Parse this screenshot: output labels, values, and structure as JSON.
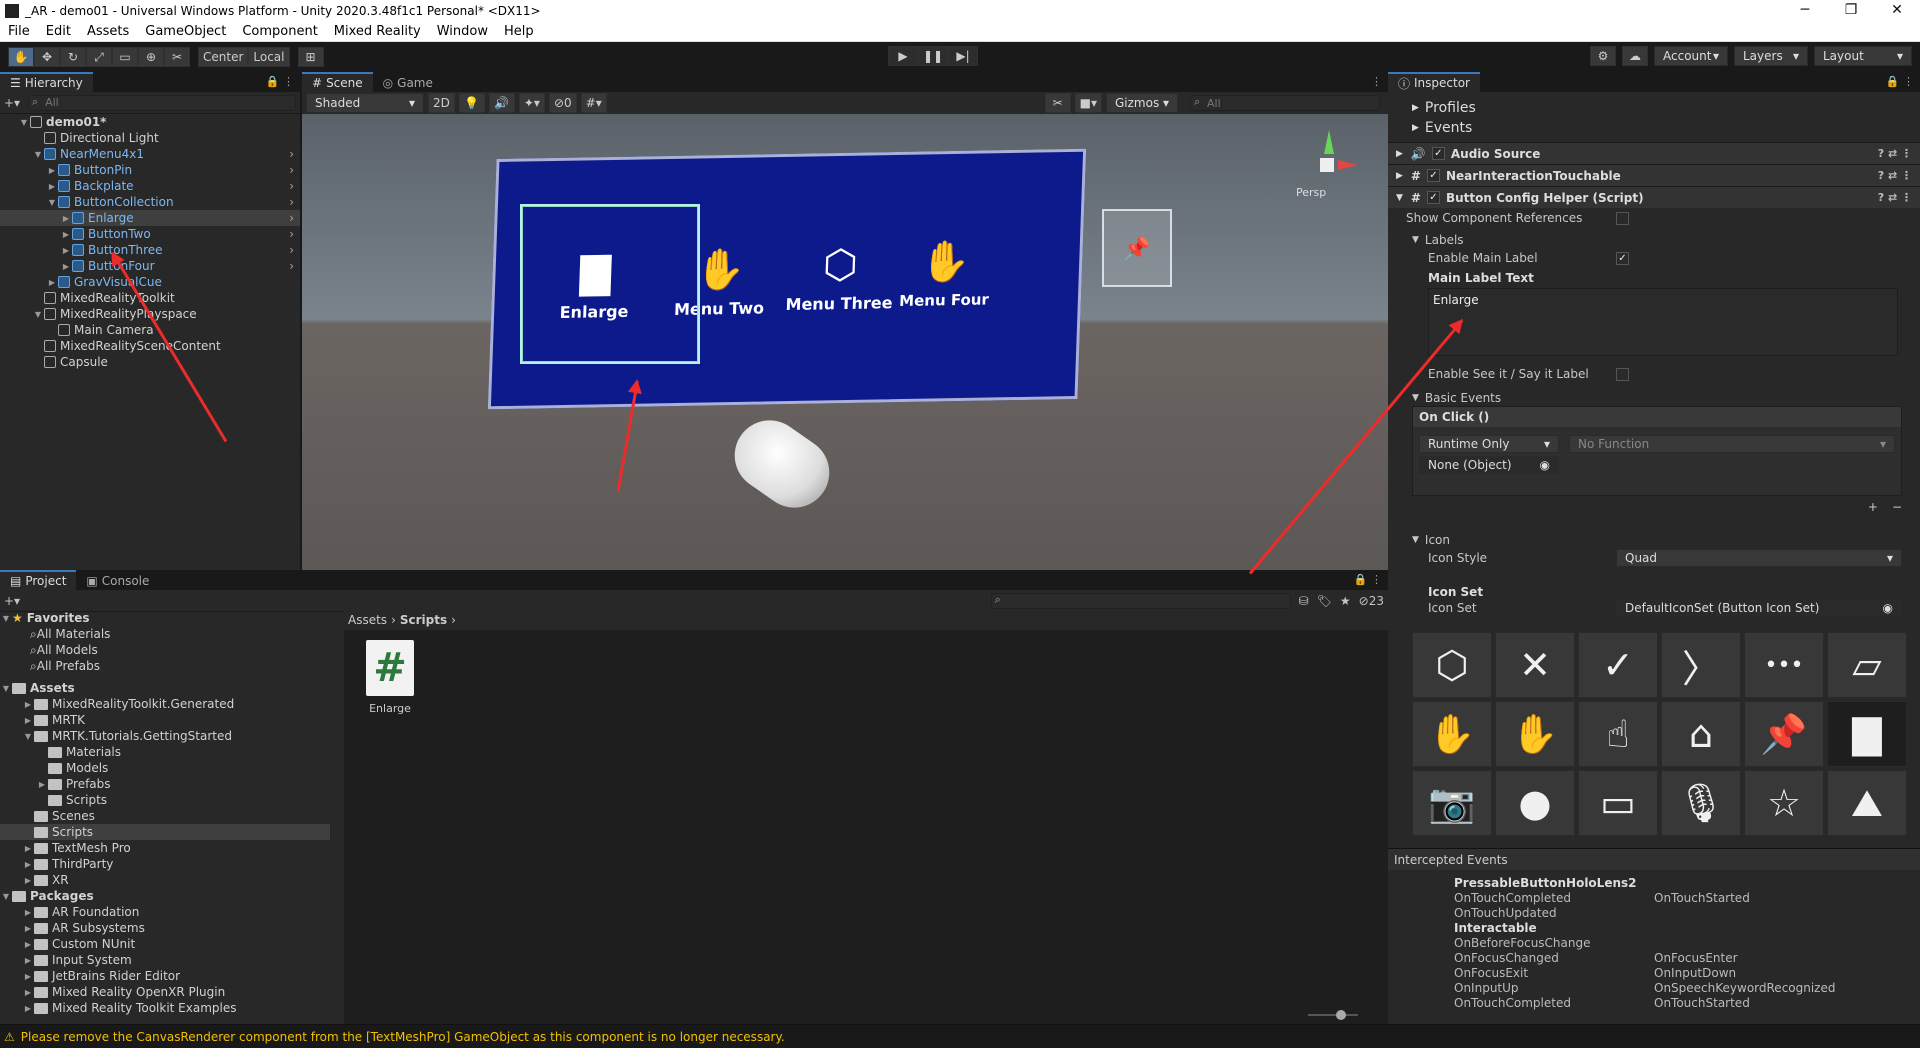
{
  "window": {
    "title": "_AR - demo01 - Universal Windows Platform - Unity 2020.3.48f1c1 Personal* <DX11>",
    "min": "─",
    "max": "❐",
    "close": "✕"
  },
  "menu": [
    "File",
    "Edit",
    "Assets",
    "GameObject",
    "Component",
    "Mixed Reality",
    "Window",
    "Help"
  ],
  "toolbar": {
    "center": "Center",
    "local": "Local",
    "account": "Account",
    "layers": "Layers",
    "layout": "Layout"
  },
  "hierarchy": {
    "tab": "Hierarchy",
    "search_placeholder": "All",
    "rows": [
      {
        "label": "demo01*",
        "depth": 0,
        "bold": true
      },
      {
        "label": "Directional Light",
        "depth": 1
      },
      {
        "label": "NearMenu4x1",
        "depth": 1,
        "blue": true
      },
      {
        "label": "ButtonPin",
        "depth": 2,
        "blue": true
      },
      {
        "label": "Backplate",
        "depth": 2,
        "blue": true
      },
      {
        "label": "ButtonCollection",
        "depth": 2,
        "blue": true
      },
      {
        "label": "Enlarge",
        "depth": 3,
        "blue": true,
        "selected": true
      },
      {
        "label": "ButtonTwo",
        "depth": 3,
        "blue": true
      },
      {
        "label": "ButtonThree",
        "depth": 3,
        "blue": true
      },
      {
        "label": "ButtonFour",
        "depth": 3,
        "blue": true
      },
      {
        "label": "GravVisualCue",
        "depth": 2,
        "blue": true
      },
      {
        "label": "MixedRealityToolkit",
        "depth": 1
      },
      {
        "label": "MixedRealityPlayspace",
        "depth": 1
      },
      {
        "label": "Main Camera",
        "depth": 2
      },
      {
        "label": "MixedRealitySceneContent",
        "depth": 1
      },
      {
        "label": "Capsule",
        "depth": 1
      }
    ]
  },
  "scene": {
    "tab_scene": "Scene",
    "tab_game": "Game",
    "shading": "Shaded",
    "mode2d": "2D",
    "gizmos": "Gizmos",
    "search_placeholder": "All",
    "persp": "Persp",
    "layers_count": "0",
    "menu_items": [
      {
        "label": "Enlarge",
        "icon": "bar-chart-icon"
      },
      {
        "label": "Menu Two",
        "icon": "hand-icon"
      },
      {
        "label": "Menu Three",
        "icon": "cube-icon"
      },
      {
        "label": "Menu Four",
        "icon": "hand-ray-icon"
      }
    ]
  },
  "project": {
    "tab_project": "Project",
    "tab_console": "Console",
    "hidden_count": "23",
    "favorites_label": "Favorites",
    "favorites": [
      "All Materials",
      "All Models",
      "All Prefabs"
    ],
    "assets_label": "Assets",
    "assets": [
      {
        "label": "MixedRealityToolkit.Generated",
        "depth": 1
      },
      {
        "label": "MRTK",
        "depth": 1
      },
      {
        "label": "MRTK.Tutorials.GettingStarted",
        "depth": 1
      },
      {
        "label": "Materials",
        "depth": 2
      },
      {
        "label": "Models",
        "depth": 2
      },
      {
        "label": "Prefabs",
        "depth": 2
      },
      {
        "label": "Scripts",
        "depth": 2
      },
      {
        "label": "Scenes",
        "depth": 1
      },
      {
        "label": "Scripts",
        "depth": 1,
        "selected": true
      },
      {
        "label": "TextMesh Pro",
        "depth": 1
      },
      {
        "label": "ThirdParty",
        "depth": 1
      },
      {
        "label": "XR",
        "depth": 1
      }
    ],
    "packages_label": "Packages",
    "packages": [
      "AR Foundation",
      "AR Subsystems",
      "Custom NUnit",
      "Input System",
      "JetBrains Rider Editor",
      "Mixed Reality OpenXR Plugin",
      "Mixed Reality Toolkit Examples"
    ],
    "breadcrumb": [
      "Assets",
      "Scripts"
    ],
    "file": {
      "name": "Enlarge",
      "glyph": "#"
    }
  },
  "inspector": {
    "tab": "Inspector",
    "sections_top": [
      "Profiles",
      "Events"
    ],
    "components": [
      "Audio Source",
      "NearInteractionTouchable",
      "Button Config Helper (Script)"
    ],
    "show_refs": "Show Component References",
    "labels_header": "Labels",
    "enable_main_label": "Enable Main Label",
    "main_label_text": "Main Label Text",
    "main_label_value": "Enlarge",
    "enable_see_it": "Enable See it / Say it Label",
    "basic_events": "Basic Events",
    "on_click": "On Click ()",
    "runtime_only": "Runtime Only",
    "no_function": "No Function",
    "none_object": "None (Object)",
    "plus": "+",
    "minus": "−",
    "icon_header": "Icon",
    "icon_style_label": "Icon Style",
    "icon_style_value": "Quad",
    "icon_set_bold": "Icon Set",
    "icon_set_label": "Icon Set",
    "icon_set_value": "DefaultIconSet (Button Icon Set)",
    "icons": [
      {
        "name": "cube-icon",
        "glyph": "⬡"
      },
      {
        "name": "close-icon",
        "glyph": "✕"
      },
      {
        "name": "check-icon",
        "glyph": "✓"
      },
      {
        "name": "chevron-right-icon",
        "glyph": "〉"
      },
      {
        "name": "more-icon",
        "glyph": "•••"
      },
      {
        "name": "bounds-icon",
        "glyph": "▱"
      },
      {
        "name": "hand-ray-icon",
        "glyph": "✋"
      },
      {
        "name": "hand-icon",
        "glyph": "✋"
      },
      {
        "name": "hand-point-icon",
        "glyph": "☝"
      },
      {
        "name": "home-icon",
        "glyph": "⌂"
      },
      {
        "name": "pin-icon",
        "glyph": "📌"
      },
      {
        "name": "bar-chart-icon",
        "glyph": "▇"
      },
      {
        "name": "camera-icon",
        "glyph": "📷"
      },
      {
        "name": "record-icon",
        "glyph": "●"
      },
      {
        "name": "chat-icon",
        "glyph": "▭"
      },
      {
        "name": "microphone-icon",
        "glyph": "🎙"
      },
      {
        "name": "star-icon",
        "glyph": "☆"
      },
      {
        "name": "map-icon",
        "glyph": "⛰"
      }
    ],
    "intercepted_header": "Intercepted Events",
    "intercepted_left": [
      "PressableButtonHoloLens2",
      "OnTouchCompleted",
      "OnTouchUpdated",
      "Interactable",
      "OnBeforeFocusChange",
      "OnFocusChanged",
      "OnFocusExit",
      "OnInputUp",
      "OnTouchCompleted"
    ],
    "intercepted_right": [
      "",
      "OnTouchStarted",
      "",
      "",
      "",
      "OnFocusEnter",
      "OnInputDown",
      "OnSpeechKeywordRecognized",
      "OnTouchStarted"
    ]
  },
  "status": {
    "message": "Please remove the CanvasRenderer component from the [TextMeshPro] GameObject as this component is no longer necessary."
  },
  "colors": {
    "accent": "#3a79bb",
    "warning": "#f0c000",
    "menu_panel": "#0d1a8c",
    "arrow": "#ee2b2b"
  }
}
